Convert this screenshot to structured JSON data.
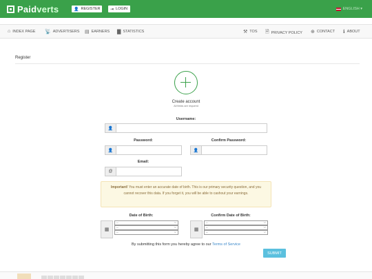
{
  "brand": {
    "paid": "Paid",
    "verts": "verts"
  },
  "top_buttons": {
    "register": "REGISTER",
    "login": "LOGIN"
  },
  "language": "ENGLISH ▾",
  "nav": {
    "index": "INDEX PAGE",
    "advertisers": "ADVERTISERS",
    "earners": "EARNERS",
    "statistics": "STATISTICS",
    "tos": "TOS",
    "privacy": "PRIVACY POLICY",
    "contact": "CONTACT",
    "about": "ABOUT"
  },
  "page": {
    "section_title": "Register",
    "create_title": "Create account",
    "create_sub": "All fields are required"
  },
  "form": {
    "username_label": "Username:",
    "password_label": "Password:",
    "confirm_password_label": "Confirm Password:",
    "email_label": "Email:",
    "dob_label": "Date of Birth:",
    "confirm_dob_label": "Confirm Date of Birth:",
    "select_value": "--"
  },
  "alert": {
    "strong": "Important!",
    "text": " You must enter an accurate date of birth. This is our primary security question, and you cannot recover this data. If you forget it, you will be able to cashout your earnings."
  },
  "agree": {
    "prefix": "By submitting this form you hereby agree to our ",
    "link": "Terms of Service"
  },
  "submit_label": "SUBMIT",
  "colors": {
    "accent": "#3aa14a",
    "submit": "#5bc0de",
    "alert_bg": "#fcf8e3"
  }
}
